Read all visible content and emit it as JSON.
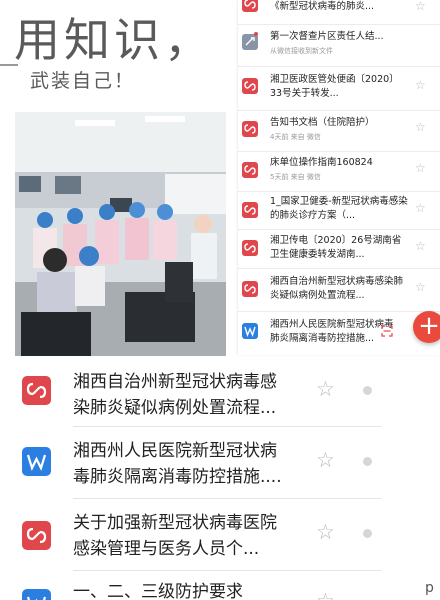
{
  "poster": {
    "title": "用知识，",
    "subtitle": "武装自己！"
  },
  "side_list": {
    "items": [
      {
        "type": "pdf",
        "title": "《新型冠状病毒的肺炎...",
        "meta": ""
      },
      {
        "type": "notice",
        "title": "第一次督查片区责任人结...",
        "meta": "从微信接收到新文件"
      },
      {
        "type": "pdf",
        "title": "湘卫医政医管处便函〔2020〕33号关于转发...",
        "meta": ""
      },
      {
        "type": "pdf",
        "title": "告知书文档（住院陪护）",
        "meta": "4天前   来自 微信"
      },
      {
        "type": "pdf",
        "title": "床单位操作指南160824",
        "meta": "5天前   来自 微信"
      },
      {
        "type": "pdf",
        "title": "1_国家卫健委-新型冠状病毒感染的肺炎诊疗方案（...",
        "meta": ""
      },
      {
        "type": "pdf",
        "title": "湘卫传电〔2020〕26号湖南省卫生健康委转发湖南...",
        "meta": ""
      },
      {
        "type": "pdf",
        "title": "湘西自治州新型冠状病毒感染肺炎疑似病例处置流程...",
        "meta": ""
      },
      {
        "type": "word",
        "title": "湘西州人民医院新型冠状病毒肺炎隔离消毒防控措施...",
        "meta": ""
      }
    ]
  },
  "main_list": {
    "items": [
      {
        "type": "pdf",
        "title": "湘西自治州新型冠状病毒感染肺炎疑似病例处置流程..."
      },
      {
        "type": "word",
        "title": "湘西州人民医院新型冠状病毒肺炎隔离消毒防控措施...."
      },
      {
        "type": "pdf",
        "title": "关于加强新型冠状病毒医院感染管理与医务人员个..."
      },
      {
        "type": "word",
        "title": "一、二、三级防护要求"
      }
    ]
  },
  "fab": {
    "label": "+"
  },
  "star_glyph": "☆",
  "colors": {
    "pdf": "#e0474c",
    "word": "#2b7fe0",
    "fab": "#ea4a3e"
  }
}
